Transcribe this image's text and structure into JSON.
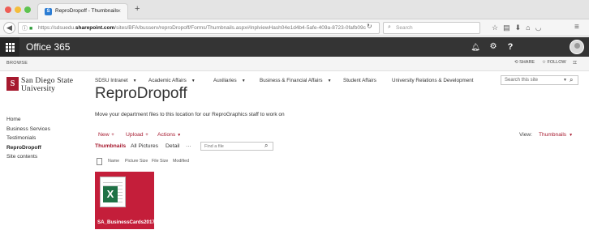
{
  "browser": {
    "tab_title": "ReproDropoff - Thumbnails",
    "tab_close": "×",
    "new_tab": "+",
    "url_prefix": "https://sdsuedu.",
    "url_domain": "sharepoint.com",
    "url_suffix": "/sites/BFA/busserv/reproDropoff/Forms/Thumbnails.aspx#InplviewHash04e1d4b4-5afe-409a-8723-0fafb09c",
    "search_placeholder": "Search"
  },
  "suite": {
    "title": "Office 365"
  },
  "ribbon": {
    "browse": "BROWSE",
    "share": "SHARE",
    "follow": "FOLLOW"
  },
  "logo": {
    "line1": "San Diego State",
    "line2": "University"
  },
  "topnav": {
    "items": [
      {
        "label": "SDSU Intranet",
        "has_dropdown": true
      },
      {
        "label": "Academic Affairs",
        "has_dropdown": true
      },
      {
        "label": "Auxiliaries",
        "has_dropdown": true
      },
      {
        "label": "Business & Financial Affairs",
        "has_dropdown": true
      },
      {
        "label": "Student Affairs",
        "has_dropdown": false
      },
      {
        "label": "University Relations & Development",
        "has_dropdown": false
      }
    ]
  },
  "site_search": {
    "placeholder": "Search this site"
  },
  "page": {
    "title": "ReproDropoff",
    "description": "Move your department files to this location for our ReproGraphics staff to work on"
  },
  "quicklaunch": {
    "items": [
      {
        "label": "Home",
        "selected": false
      },
      {
        "label": "Business Services",
        "selected": false
      },
      {
        "label": "Testimonials",
        "selected": false
      },
      {
        "label": "ReproDropoff",
        "selected": true
      },
      {
        "label": "Site contents",
        "selected": false
      }
    ]
  },
  "commands": {
    "new": "New",
    "upload": "Upload",
    "actions": "Actions",
    "view_label": "View:",
    "view_value": "Thumbnails"
  },
  "views": {
    "tabs": [
      "Thumbnails",
      "All Pictures",
      "Detail"
    ],
    "more": "···",
    "find_placeholder": "Find a file"
  },
  "columns": [
    "Name",
    "Picture Size",
    "File Size",
    "Modified"
  ],
  "file": {
    "name": "SA_BusinessCards2017",
    "icon": "excel-icon"
  },
  "colors": {
    "accent": "#a6192e",
    "suite_bar": "#343434",
    "excel_green": "#1e7145",
    "thumb_bg": "#c41e3a"
  }
}
